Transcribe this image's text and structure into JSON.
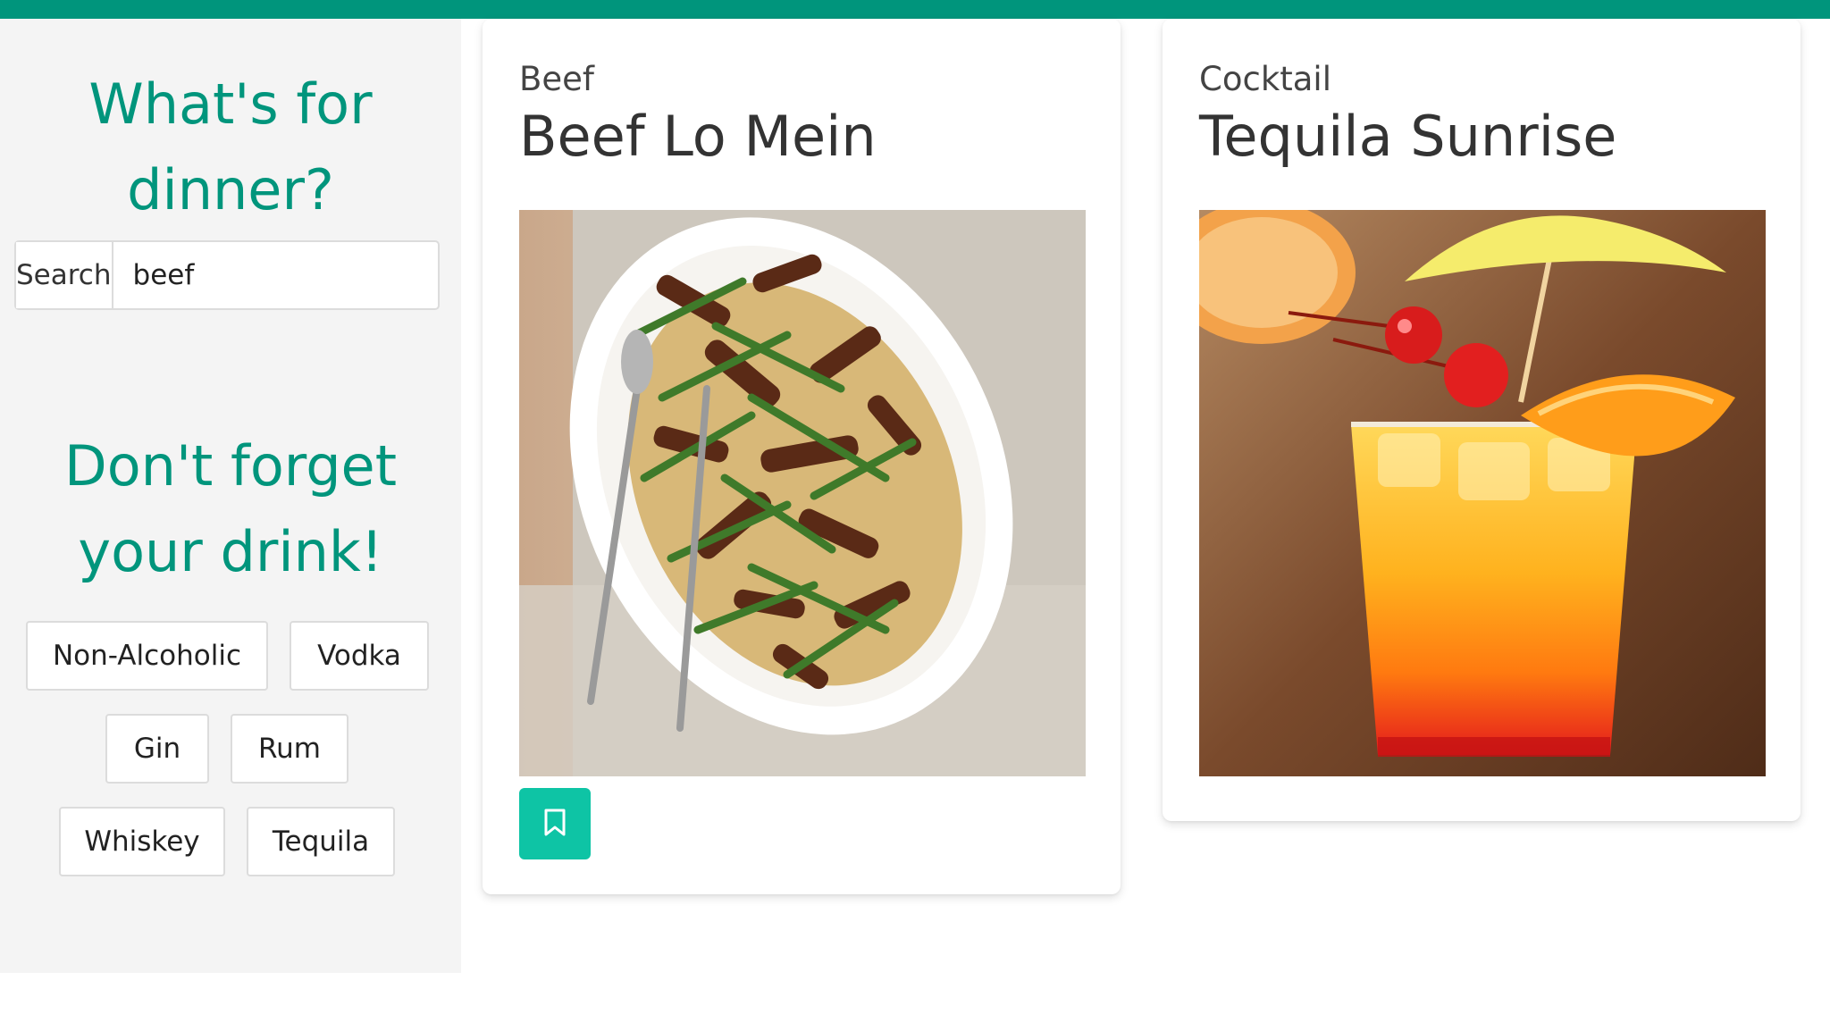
{
  "sidebar": {
    "dinner_heading_line1": "What's for",
    "dinner_heading_line2": "dinner?",
    "search_button_label": "Search",
    "search_value": "beef",
    "drink_heading_line1": "Don't forget",
    "drink_heading_line2": "your drink!",
    "drink_buttons": [
      "Non-Alcoholic",
      "Vodka",
      "Gin",
      "Rum",
      "Whiskey",
      "Tequila"
    ]
  },
  "cards": [
    {
      "category": "Beef",
      "title": "Beef Lo Mein",
      "image_icon": "beef-lo-mein-photo",
      "has_bookmark": true
    },
    {
      "category": "Cocktail",
      "title": "Tequila Sunrise",
      "image_icon": "tequila-sunrise-photo",
      "has_bookmark": false
    }
  ],
  "colors": {
    "accent": "#00957c",
    "bookmark_button": "#0ec4a5",
    "sidebar_bg": "#f4f4f4"
  }
}
